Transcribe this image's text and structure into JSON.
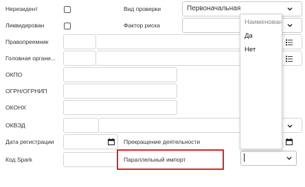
{
  "form": {
    "nonresident_label": "Нерезидент",
    "liquidated_label": "Ликвидирован",
    "successor_label": "Правопреемник",
    "parent_org_label": "Головная органи...",
    "okpo_label": "ОКПО",
    "ogrn_label": "ОГРН/ОГРНИП",
    "okonh_label": "ОКОНХ",
    "okved_label": "ОКВЭД",
    "reg_date_label": "Дата регистрации",
    "spark_label": "Код Spark",
    "check_type_label": "Вид проверки",
    "check_type_value": "Первоначальная",
    "risk_factor_label": "Фактор риска",
    "termination_label": "Прекращение деятельности",
    "parallel_import_label": "Параллельный импорт"
  },
  "dropdown": {
    "header": "Наименован",
    "options": [
      "Да",
      "Нет"
    ]
  },
  "colors": {
    "highlight": "#e02020",
    "border": "#d4d4d4"
  }
}
